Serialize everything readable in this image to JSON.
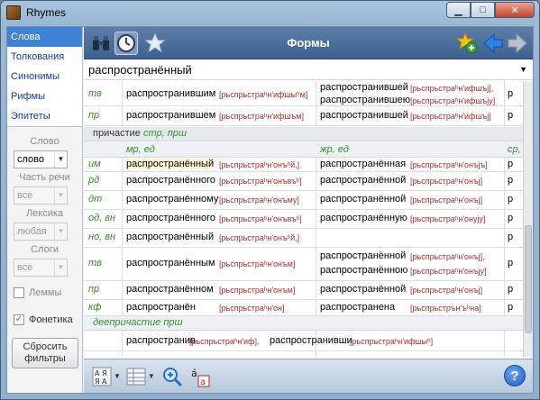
{
  "window": {
    "title": "Rhymes",
    "buttons": {
      "minimize": "▁",
      "maximize": "□",
      "close": "✕"
    }
  },
  "sidebar": {
    "items": [
      {
        "label": "Слова",
        "active": true
      },
      {
        "label": "Толкования",
        "active": false
      },
      {
        "label": "Синонимы",
        "active": false
      },
      {
        "label": "Рифмы",
        "active": false
      },
      {
        "label": "Эпитеты",
        "active": false
      }
    ],
    "filters": {
      "word_label": "Слово",
      "word_value": "слово",
      "pos_label": "Часть речи",
      "pos_value": "все",
      "lexicon_label": "Лексика",
      "lexicon_value": "любая",
      "syllables_label": "Слоги",
      "syllables_value": "все",
      "lemmas_label": "Леммы",
      "lemmas_checked": false,
      "phonetics_label": "Фонетика",
      "phonetics_checked": true,
      "reset_label_line1": "Сбросить",
      "reset_label_line2": "фильтры"
    }
  },
  "toolbar": {
    "title": "Формы"
  },
  "word_field": {
    "value": "распространённый"
  },
  "grid": {
    "top_rows": [
      {
        "case": "тв",
        "form": "распространившим",
        "translit": "[рьспрьстраʰн'ифшыʰм]",
        "form2a": "распространившей",
        "translit2a": "[рьспрьстраʰн'ифшъj],",
        "form2b": "распространившею",
        "translit2b": "[рьспрьстраʰн'ифшъjу]",
        "col3": "р"
      },
      {
        "case": "пр",
        "form": "распространившем",
        "translit": "[рьспрьстраʰн'ифшъм]",
        "form2a": "распространившей",
        "translit2a": "[рьспрьстраʰн'ифшъj]",
        "col3": "р"
      }
    ],
    "section1": {
      "prefix": "причастие ",
      "suffix": "стр, прш"
    },
    "col_headers": {
      "c1": "мр, ед",
      "c2": "жр, ед",
      "c3": "ср,"
    },
    "rows": [
      {
        "case": "им",
        "form": "распространённый",
        "translit": "[рьспрьстраʰн'онъʰй,]",
        "form2a": "распространённая",
        "translit2a": "[рьспрьстраʰн'онъjъ]",
        "col3": "р"
      },
      {
        "case": "рд",
        "form": "распространённого",
        "translit": "[рьспрьстраʰн'онъвъʰ]",
        "form2a": "распространённой",
        "translit2a": "[рьспрьстраʰн'онъj]",
        "col3": "р"
      },
      {
        "case": "дт",
        "form": "распространённому",
        "translit": "[рьспрьстраʰн'онъму]",
        "form2a": "распространённой",
        "translit2a": "[рьспрьстраʰн'онъj]",
        "col3": "р"
      },
      {
        "case": "од, вн",
        "form": "распространённого",
        "translit": "[рьспрьстраʰн'онъвъʰ]",
        "form2a": "распространённую",
        "translit2a": "[рьспрьстраʰн'онуjу]",
        "col3": "р"
      },
      {
        "case": "но, вн",
        "form": "распространённый",
        "translit": "[рьспрьстраʰн'онъʰй,]",
        "col3": "р"
      },
      {
        "case": "тв",
        "form": "распространённым",
        "translit": "[рьспрьстраʰн'онъм]",
        "form2a": "распространённой",
        "translit2a": "[рьспрьстраʰн'онъj],",
        "form2b": "распространённою",
        "translit2b": "[рьспрьстраʰн'онъjу]",
        "col3": "р"
      },
      {
        "case": "пр",
        "form": "распространённом",
        "translit": "[рьспрьстраʰн'онъм]",
        "form2a": "распространённой",
        "translit2a": "[рьспрьстраʰн'онъj]",
        "col3": "р"
      },
      {
        "case": "кф",
        "form": "распространён",
        "translit": "[рьспрьстраʰн'он]",
        "form2a": "распространена",
        "translit2a": "[рьспрьстрън'ъʰна]",
        "col3": "р"
      }
    ],
    "section2": {
      "label": "деепричастие прш"
    },
    "gerund": {
      "form1": "распространив",
      "translit1": "[рьспрьстраʰн'иф],",
      "form2": "распространивши",
      "translit2": "[рьспрьстраʰн'ифшыʰ]"
    }
  },
  "colors": {
    "accent": "#3f82d6",
    "case_green": "#3a8c2f",
    "translit_red": "#b02a2a",
    "toolbar": "#4d6e9c"
  },
  "icons": [
    "binoculars-icon",
    "clock-icon",
    "star-icon",
    "add-favorite-icon",
    "back-arrow-icon",
    "forward-arrow-icon",
    "sort-icon",
    "table-view-icon",
    "zoom-icon",
    "font-size-icon",
    "help-icon"
  ]
}
